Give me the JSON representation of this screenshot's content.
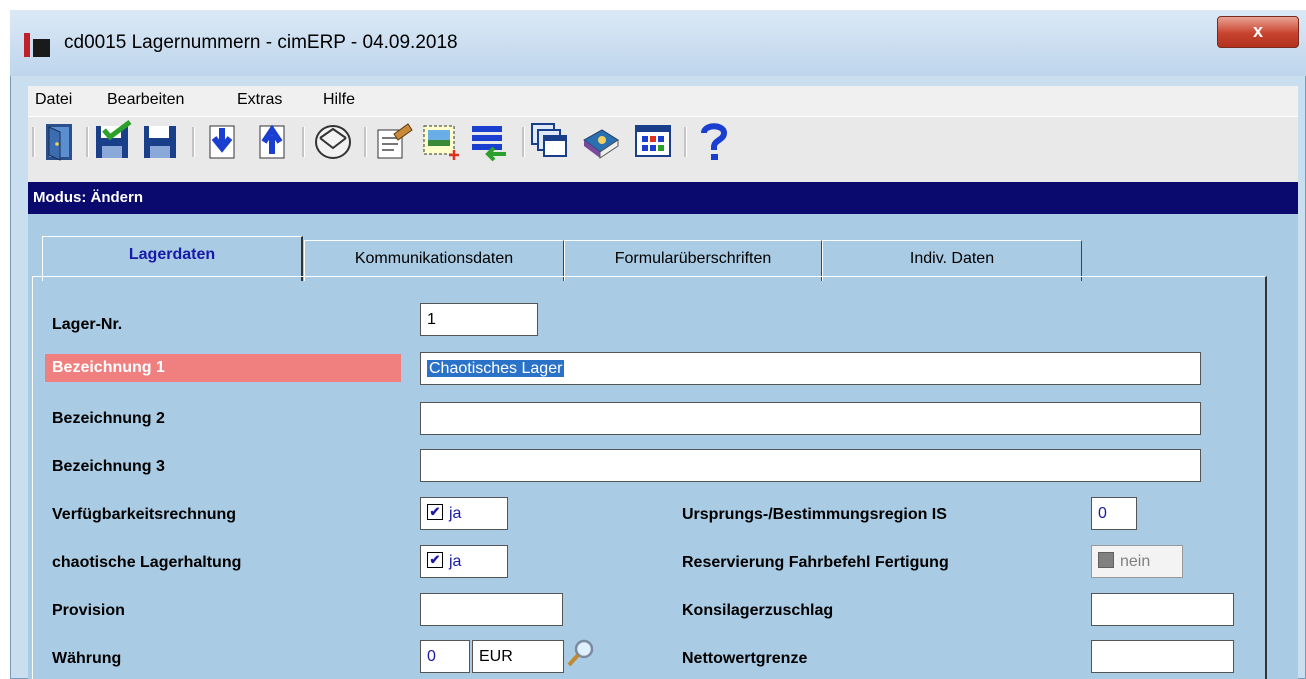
{
  "window": {
    "title": "cd0015 Lagernummern - cimERP - 04.09.2018",
    "close_label": "x"
  },
  "menu": [
    "Datei",
    "Bearbeiten",
    "Extras",
    "Hilfe"
  ],
  "toolbar": [
    "exit-door-icon",
    "save-check-icon",
    "save-icon",
    "arrow-down-icon",
    "arrow-up-icon",
    "envelope-icon",
    "edit-document-icon",
    "new-record-icon",
    "transfer-list-icon",
    "windows-icon",
    "book-icon",
    "calculator-icon",
    "help-icon"
  ],
  "mode": "Modus: Ändern",
  "tabs": [
    "Lagerdaten",
    "Kommunikationsdaten",
    "Formularüberschriften",
    "Indiv. Daten"
  ],
  "form": {
    "lager_nr": {
      "label": "Lager-Nr.",
      "value": "1"
    },
    "bez1": {
      "label": "Bezeichnung 1",
      "value": "Chaotisches Lager"
    },
    "bez2": {
      "label": "Bezeichnung 2",
      "value": ""
    },
    "bez3": {
      "label": "Bezeichnung 3",
      "value": ""
    },
    "verf": {
      "label": "Verfügbarkeitsrechnung",
      "check": "✔",
      "value": "ja"
    },
    "chaot": {
      "label": "chaotische Lagerhaltung",
      "check": "✔",
      "value": "ja"
    },
    "provision": {
      "label": "Provision",
      "value": ""
    },
    "waehrung": {
      "label": "Währung",
      "code": "0",
      "currency": "EUR"
    },
    "ursprung": {
      "label": "Ursprungs-/Bestimmungsregion IS",
      "value": "0"
    },
    "reserv": {
      "label": "Reservierung Fahrbefehl Fertigung",
      "value": "nein"
    },
    "konsi": {
      "label": "Konsilagerzuschlag",
      "value": ""
    },
    "netto": {
      "label": "Nettowertgrenze",
      "value": ""
    }
  },
  "colors": {
    "mode_bar": "#0a0a6e",
    "panel_bg": "#a9cbe4",
    "highlight_label": "#f08080",
    "active_tab_text": "#1a1aa8"
  }
}
